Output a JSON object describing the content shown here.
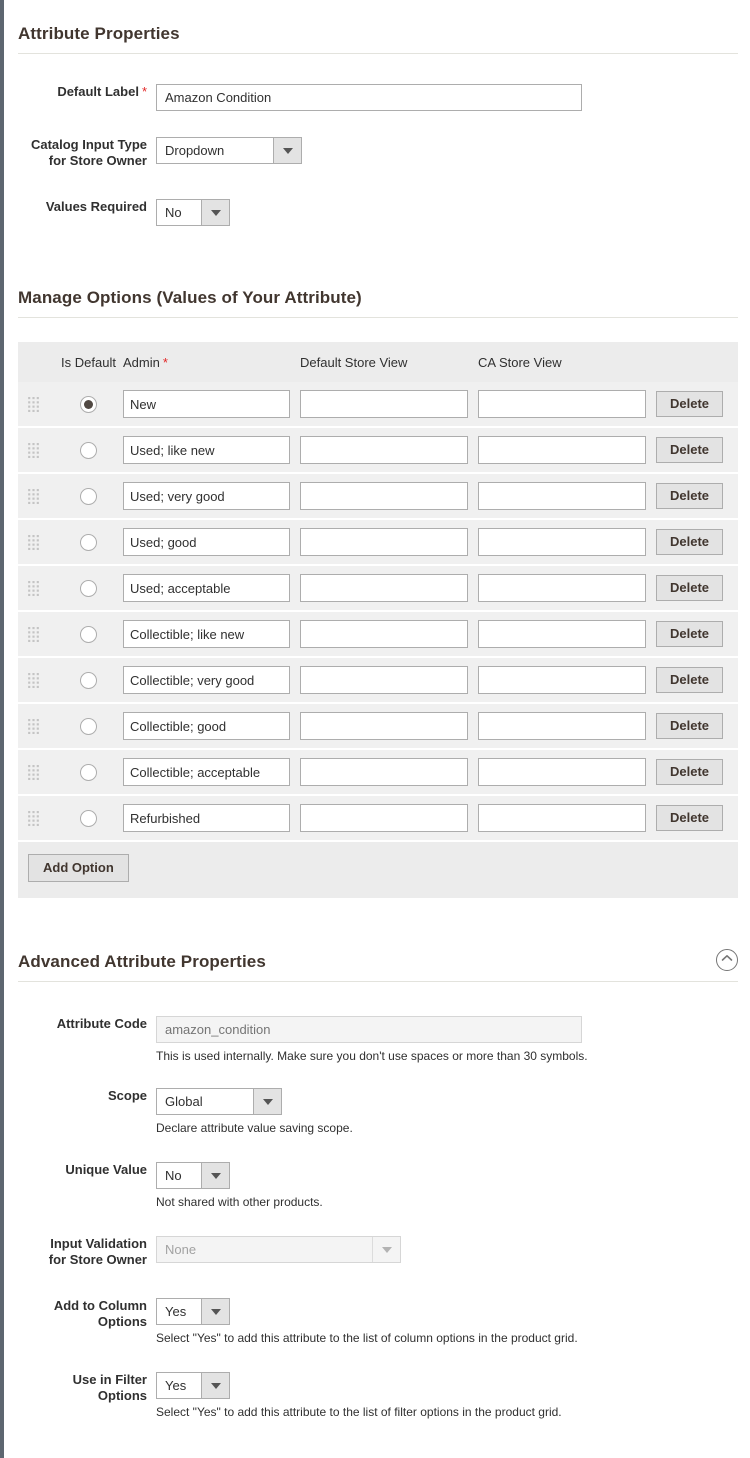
{
  "attribute_properties": {
    "title": "Attribute Properties",
    "default_label": {
      "label": "Default Label",
      "required_mark": "*",
      "value": "Amazon Condition"
    },
    "catalog_input_type": {
      "label_line1": "Catalog Input Type",
      "label_line2": "for Store Owner",
      "value": "Dropdown"
    },
    "values_required": {
      "label": "Values Required",
      "value": "No"
    }
  },
  "manage_options": {
    "title": "Manage Options (Values of Your Attribute)",
    "columns": {
      "is_default": "Is Default",
      "admin": "Admin",
      "admin_required_mark": "*",
      "default_store_view": "Default Store View",
      "ca_store_view": "CA Store View"
    },
    "delete_label": "Delete",
    "add_option_label": "Add Option",
    "rows": [
      {
        "admin": "New",
        "default_store_view": "",
        "ca_store_view": "",
        "is_default": true
      },
      {
        "admin": "Used; like new",
        "default_store_view": "",
        "ca_store_view": "",
        "is_default": false
      },
      {
        "admin": "Used; very good",
        "default_store_view": "",
        "ca_store_view": "",
        "is_default": false
      },
      {
        "admin": "Used; good",
        "default_store_view": "",
        "ca_store_view": "",
        "is_default": false
      },
      {
        "admin": "Used; acceptable",
        "default_store_view": "",
        "ca_store_view": "",
        "is_default": false
      },
      {
        "admin": "Collectible; like new",
        "default_store_view": "",
        "ca_store_view": "",
        "is_default": false
      },
      {
        "admin": "Collectible; very good",
        "default_store_view": "",
        "ca_store_view": "",
        "is_default": false
      },
      {
        "admin": "Collectible; good",
        "default_store_view": "",
        "ca_store_view": "",
        "is_default": false
      },
      {
        "admin": "Collectible; acceptable",
        "default_store_view": "",
        "ca_store_view": "",
        "is_default": false
      },
      {
        "admin": "Refurbished",
        "default_store_view": "",
        "ca_store_view": "",
        "is_default": false
      }
    ]
  },
  "advanced_properties": {
    "title": "Advanced Attribute Properties",
    "collapse_icon": "chevron-up-icon",
    "attribute_code": {
      "label": "Attribute Code",
      "placeholder": "amazon_condition",
      "value": "",
      "note": "This is used internally. Make sure you don't use spaces or more than 30 symbols."
    },
    "scope": {
      "label": "Scope",
      "value": "Global",
      "note": "Declare attribute value saving scope."
    },
    "unique_value": {
      "label": "Unique Value",
      "value": "No",
      "note": "Not shared with other products."
    },
    "input_validation": {
      "label_line1": "Input Validation",
      "label_line2": "for Store Owner",
      "value": "None",
      "note": ""
    },
    "add_to_column_options": {
      "label_line1": "Add to Column",
      "label_line2": "Options",
      "value": "Yes",
      "note": "Select \"Yes\" to add this attribute to the list of column options in the product grid."
    },
    "use_in_filter_options": {
      "label_line1": "Use in Filter",
      "label_line2": "Options",
      "value": "Yes",
      "note": "Select \"Yes\" to add this attribute to the list of filter options in the product grid."
    }
  },
  "colors": {
    "required_asterisk": "#e22626",
    "heading": "#41362f",
    "row_background": "#f0f0f0",
    "header_background": "#ececec",
    "radio_selected": "#514943"
  }
}
